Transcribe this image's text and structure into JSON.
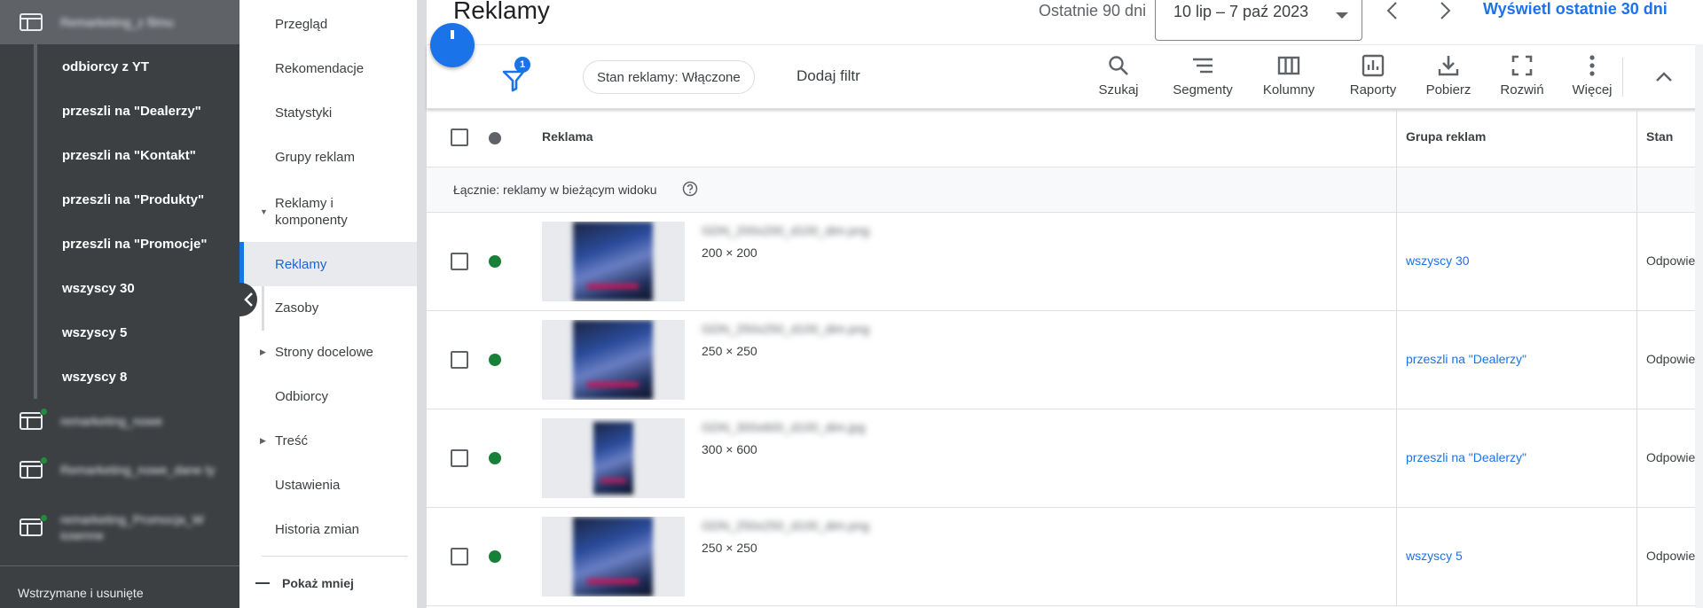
{
  "left_nav": {
    "campaigns_top": [
      {
        "name": "Remarketing_z filmu",
        "active": true
      }
    ],
    "ad_groups": [
      {
        "label": "odbiorcy z YT"
      },
      {
        "label": "przeszli na \"Dealerzy\""
      },
      {
        "label": "przeszli na \"Kontakt\""
      },
      {
        "label": "przeszli na \"Produkty\""
      },
      {
        "label": "przeszli na \"Promocje\""
      },
      {
        "label": "wszyscy 30"
      },
      {
        "label": "wszyscy 5"
      },
      {
        "label": "wszyscy 8"
      }
    ],
    "campaigns_bottom": [
      {
        "name": "remarketing_nowe"
      },
      {
        "name": "Remarketing_nowe_dane ty"
      },
      {
        "name": "remarketing_Promocja_W iosenne"
      }
    ],
    "footer_label": "Wstrzymane i usunięte"
  },
  "page_menu": {
    "items": [
      {
        "label": "Przegląd"
      },
      {
        "label": "Rekomendacje"
      },
      {
        "label": "Statystyki"
      },
      {
        "label": "Grupy reklam"
      },
      {
        "label": "Reklamy i komponenty"
      },
      {
        "label": "Reklamy"
      },
      {
        "label": "Zasoby"
      },
      {
        "label": "Strony docelowe"
      },
      {
        "label": "Odbiorcy"
      },
      {
        "label": "Treść"
      },
      {
        "label": "Ustawienia"
      },
      {
        "label": "Historia zmian"
      }
    ],
    "show_less": "Pokaż mniej"
  },
  "header": {
    "title": "Reklamy",
    "range_label": "Ostatnie 90 dni",
    "date_range": "10 lip – 7 paź 2023",
    "show_last_30": "Wyświetl ostatnie 30 dni"
  },
  "toolbar": {
    "filter_count": "1",
    "filter_chip": "Stan reklamy: Włączone",
    "add_filter": "Dodaj filtr",
    "tools": [
      {
        "label": "Szukaj",
        "icon": "search-icon"
      },
      {
        "label": "Segmenty",
        "icon": "segment-icon"
      },
      {
        "label": "Kolumny",
        "icon": "columns-icon"
      },
      {
        "label": "Raporty",
        "icon": "reports-icon"
      },
      {
        "label": "Pobierz",
        "icon": "download-icon"
      },
      {
        "label": "Rozwiń",
        "icon": "expand-icon"
      },
      {
        "label": "Więcej",
        "icon": "more-vert-icon"
      }
    ]
  },
  "table": {
    "columns": {
      "ad": "Reklama",
      "ad_group": "Grupa reklam",
      "status": "Stan"
    },
    "total_label": "Łącznie: reklamy w bieżącym widoku",
    "rows": [
      {
        "file_name": "GDN_200x200_d100_dim.png",
        "dimensions": "200 × 200",
        "ad_group": "wszyscy 30",
        "status": "Odpowiednia",
        "status_color": "#188038"
      },
      {
        "file_name": "GDN_250x250_d100_dim.png",
        "dimensions": "250 × 250",
        "ad_group": "przeszli na \"Dealerzy\"",
        "status": "Odpowiednia",
        "status_color": "#188038"
      },
      {
        "file_name": "GDN_300x600_d100_dim.jpg",
        "dimensions": "300 × 600",
        "ad_group": "przeszli na \"Dealerzy\"",
        "status": "Odpowiednia",
        "status_color": "#188038"
      },
      {
        "file_name": "GDN_250x250_d100_dim.png",
        "dimensions": "250 × 250",
        "ad_group": "wszyscy 5",
        "status": "Odpowiednia",
        "status_color": "#188038"
      }
    ]
  },
  "colors": {
    "accent": "#1a73e8",
    "sidebar": "#3c4043",
    "enabled_status": "#188038"
  }
}
